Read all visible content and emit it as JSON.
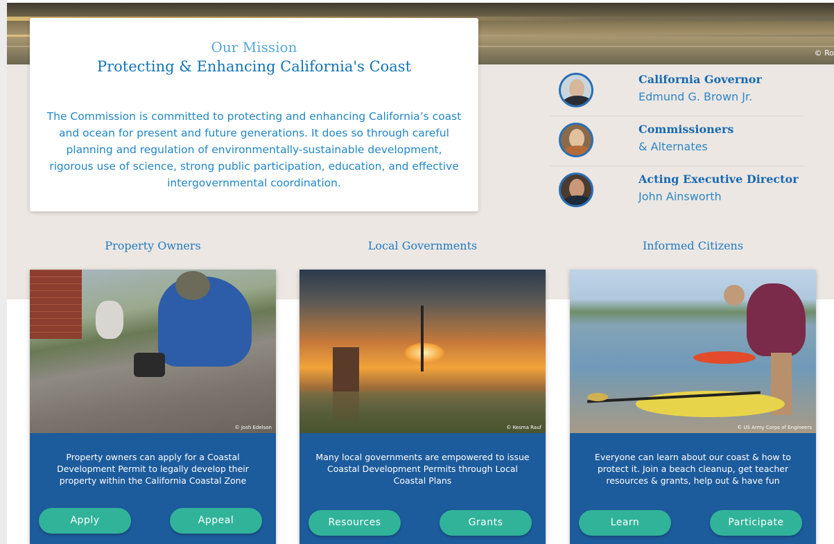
{
  "hero": {
    "credit": "© Ro"
  },
  "mission": {
    "kicker": "Our Mission",
    "headline": "Protecting & Enhancing California's Coast",
    "body": "The Commission is committed to protecting and enhancing California’s coast and ocean for present and future generations. It does so through careful planning and regulation of environmentally-sustainable development, rigorous use of science, strong public participation, education, and effective intergovernmental coordination."
  },
  "leaders": [
    {
      "title": "California Governor",
      "sub": "Edmund G. Brown Jr.",
      "shirt": "#2b2b33"
    },
    {
      "title": "Commissioners",
      "sub": "& Alternates",
      "shirt": "#b56a3a"
    },
    {
      "title": "Acting Executive Director",
      "sub": "John Ainsworth",
      "shirt": "#1c2a3a"
    }
  ],
  "sections": [
    {
      "title": "Property Owners",
      "photo_credit": "© Josh Edelson",
      "description": "Property owners can apply for a Coastal Development Permit to legally develop their property within the California Coastal Zone",
      "buttons": [
        "Apply",
        "Appeal"
      ]
    },
    {
      "title": "Local Governments",
      "photo_credit": "© Kesma Rauf",
      "description": "Many local governments are empowered to issue Coastal Development Permits through Local Coastal Plans",
      "buttons": [
        "Resources",
        "Grants"
      ]
    },
    {
      "title": "Informed Citizens",
      "photo_credit": "© US Army Corps of Engineers",
      "description": "Everyone can learn about our coast & how to protect it. Join a beach cleanup, get teacher resources & grants, help out & have fun",
      "buttons": [
        "Learn",
        "Participate"
      ]
    }
  ],
  "colors": {
    "accent_blue": "#1769b0",
    "card_blue": "#1c5b9c",
    "button_teal": "#31b39a",
    "band_beige": "#ece7e3"
  }
}
